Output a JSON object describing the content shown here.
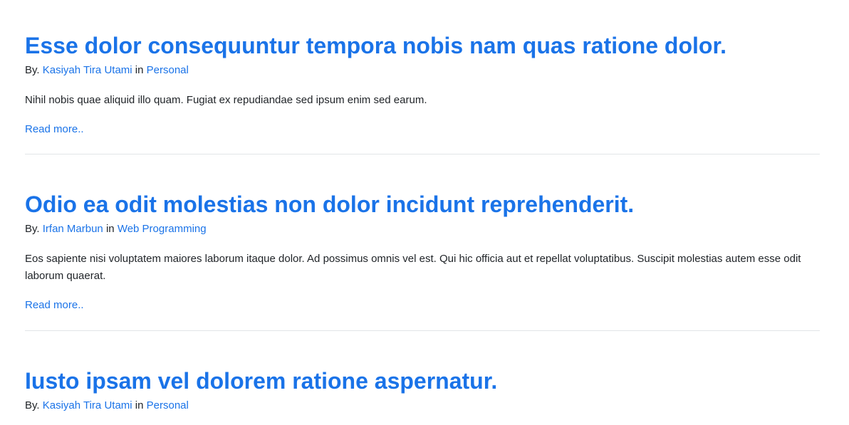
{
  "meta_by_label": "By.",
  "meta_in_label": "in",
  "posts": [
    {
      "title": "Esse dolor consequuntur tempora nobis nam quas ratione dolor.",
      "author": "Kasiyah Tira Utami",
      "category": "Personal",
      "excerpt": "Nihil nobis quae aliquid illo quam. Fugiat ex repudiandae sed ipsum enim sed earum.",
      "read_more": "Read more.."
    },
    {
      "title": "Odio ea odit molestias non dolor incidunt reprehenderit.",
      "author": "Irfan Marbun",
      "category": "Web Programming",
      "excerpt": "Eos sapiente nisi voluptatem maiores laborum itaque dolor. Ad possimus omnis vel est. Qui hic officia aut et repellat voluptatibus. Suscipit molestias autem esse odit laborum quaerat.",
      "read_more": "Read more.."
    },
    {
      "title": "Iusto ipsam vel dolorem ratione aspernatur.",
      "author": "Kasiyah Tira Utami",
      "category": "Personal"
    }
  ]
}
